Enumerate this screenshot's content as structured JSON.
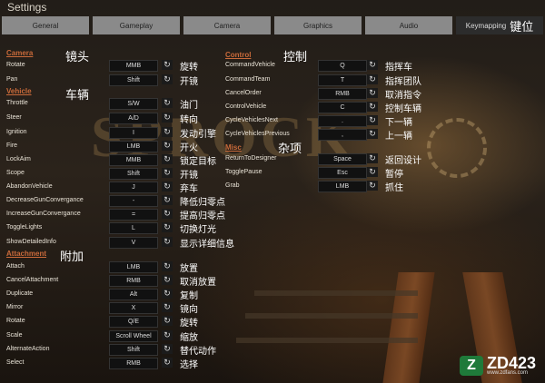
{
  "window_title": "Settings",
  "tabs": [
    {
      "label": "General"
    },
    {
      "label": "Gameplay"
    },
    {
      "label": "Camera"
    },
    {
      "label": "Graphics"
    },
    {
      "label": "Audio"
    },
    {
      "label": "Keymapping",
      "cn": "键位",
      "active": true
    }
  ],
  "left_sections": [
    {
      "title": "Camera",
      "cn": "镜头"
    },
    {
      "title": "Vehicle",
      "cn": "车辆"
    },
    {
      "title": "Attachment",
      "cn": "附加"
    }
  ],
  "right_sections": [
    {
      "title": "Control",
      "cn": "控制"
    },
    {
      "title": "Misc",
      "cn": "杂项"
    }
  ],
  "left_rows": [
    {
      "name": "Rotate",
      "key": "MMB",
      "cn": "旋转"
    },
    {
      "name": "Pan",
      "key": "Shift",
      "cn": "开镜"
    },
    {
      "name": "Throttle",
      "key": "S/W",
      "cn": "油门"
    },
    {
      "name": "Steer",
      "key": "A/D",
      "cn": "转向"
    },
    {
      "name": "Ignition",
      "key": "I",
      "cn": "发动引擎"
    },
    {
      "name": "Fire",
      "key": "LMB",
      "cn": "开火"
    },
    {
      "name": "LockAim",
      "key": "MMB",
      "cn": "锁定目标"
    },
    {
      "name": "Scope",
      "key": "Shift",
      "cn": "开镜"
    },
    {
      "name": "AbandonVehicle",
      "key": "J",
      "cn": "弃车"
    },
    {
      "name": "DecreaseGunConvergance",
      "key": "-",
      "cn": "降低归零点"
    },
    {
      "name": "IncreaseGunConvergance",
      "key": "=",
      "cn": "提高归零点"
    },
    {
      "name": "ToggleLights",
      "key": "L",
      "cn": "切换灯光"
    },
    {
      "name": "ShowDetailedInfo",
      "key": "V",
      "cn": "显示详细信息"
    },
    {
      "name": "Attach",
      "key": "LMB",
      "cn": "放置"
    },
    {
      "name": "CancelAttachment",
      "key": "RMB",
      "cn": "取消放置"
    },
    {
      "name": "Duplicate",
      "key": "Alt",
      "cn": "复制"
    },
    {
      "name": "Mirror",
      "key": "X",
      "cn": "镜向"
    },
    {
      "name": "Rotate",
      "key": "Q/E",
      "cn": "旋转"
    },
    {
      "name": "Scale",
      "key": "Scroll Wheel",
      "cn": "缩放"
    },
    {
      "name": "AlternateAction",
      "key": "Shift",
      "cn": "替代动作"
    },
    {
      "name": "Select",
      "key": "RMB",
      "cn": "选择"
    }
  ],
  "right_rows": [
    {
      "name": "CommandVehicle",
      "key": "Q",
      "cn": "指挥车"
    },
    {
      "name": "CommandTeam",
      "key": "T",
      "cn": "指挥团队"
    },
    {
      "name": "CancelOrder",
      "key": "RMB",
      "cn": "取消指令"
    },
    {
      "name": "ControlVehicle",
      "key": "C",
      "cn": "控制车辆"
    },
    {
      "name": "CycleVehiclesNext",
      "key": ".",
      "cn": "下一辆"
    },
    {
      "name": "CycleVehiclesPrevious",
      "key": ",",
      "cn": "上一辆"
    },
    {
      "name": "ReturnToDesigner",
      "key": "Space",
      "cn": "返回设计"
    },
    {
      "name": "TogglePause",
      "key": "Esc",
      "cn": "暂停"
    },
    {
      "name": "Grab",
      "key": "LMB",
      "cn": "抓住"
    }
  ],
  "background_text": "SPROCK",
  "reset_glyph": "↻",
  "watermark": {
    "badge": "Z",
    "main": "ZD423",
    "sub": "www.zdfans.com"
  }
}
